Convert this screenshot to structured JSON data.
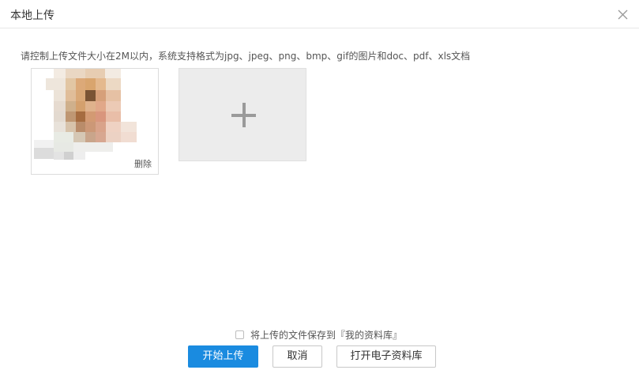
{
  "dialog": {
    "title": "本地上传",
    "close_icon": "close-icon"
  },
  "hint": "请控制上传文件大小在2M以内，系统支持格式为jpg、jpeg、png、bmp、gif的图片和doc、pdf、xls文档",
  "uploaded": {
    "delete_label": "删除"
  },
  "add": {
    "icon": "plus-icon"
  },
  "save_option": {
    "label": "将上传的文件保存到『我的资料库』",
    "checked": false
  },
  "buttons": {
    "start_upload": "开始上传",
    "cancel": "取消",
    "open_library": "打开电子资料库"
  },
  "colors": {
    "primary": "#1a8be0",
    "placeholder_bg": "#ececec"
  }
}
